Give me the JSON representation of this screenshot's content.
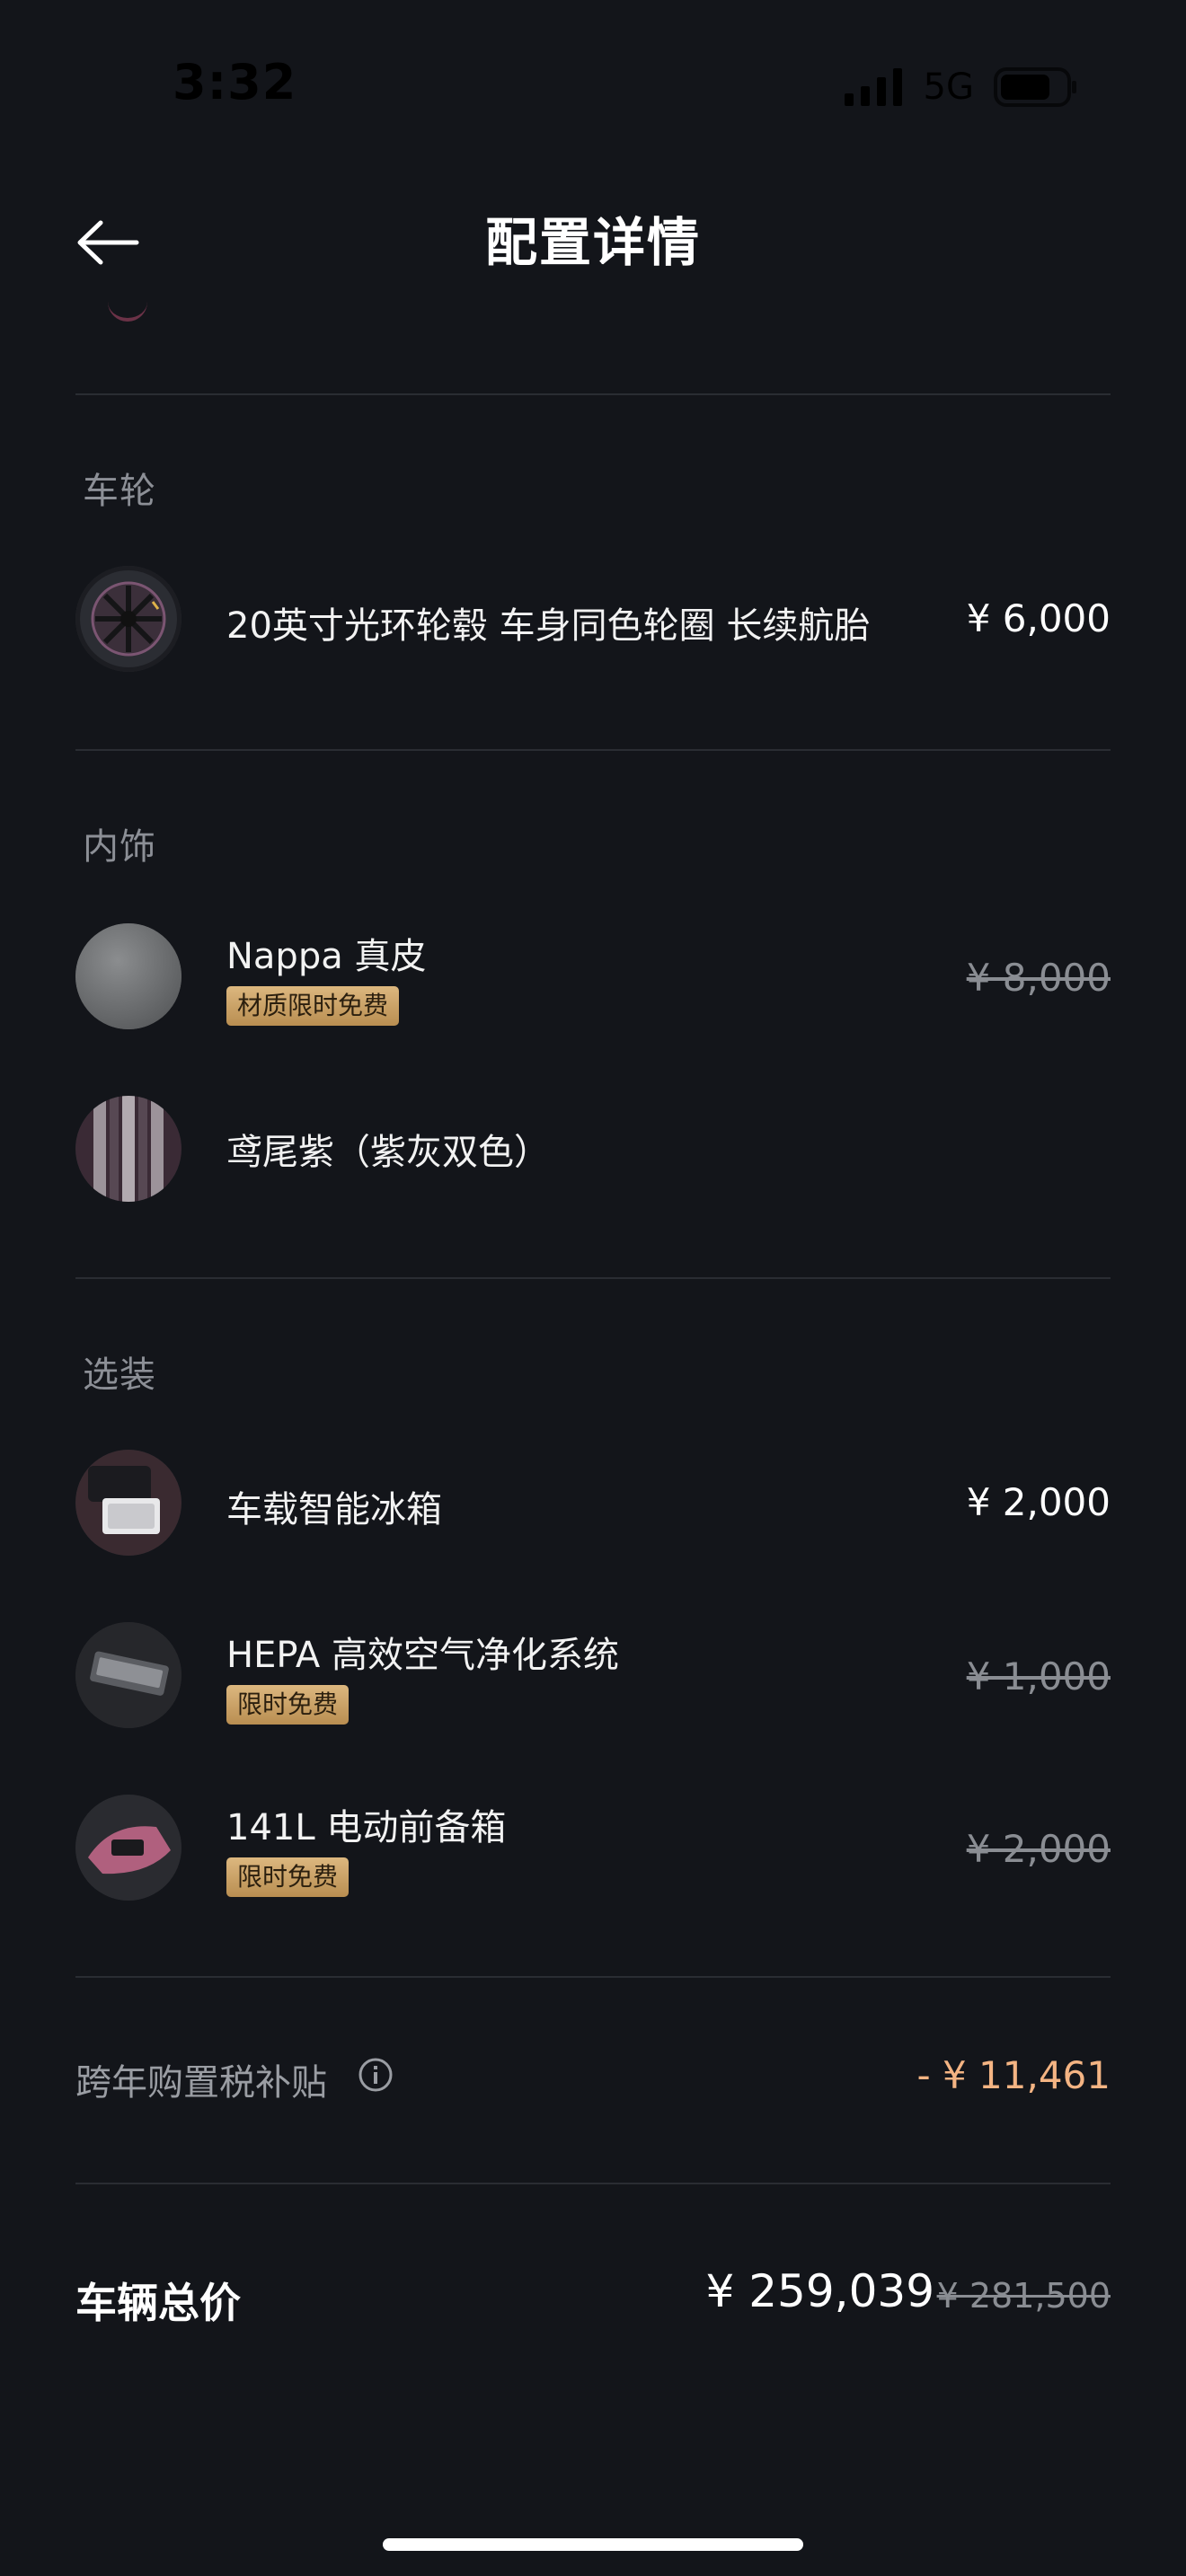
{
  "status_bar": {
    "time": "3:32",
    "network": "5G"
  },
  "header": {
    "title": "配置详情"
  },
  "sections": {
    "wheels": {
      "title": "车轮",
      "items": [
        {
          "name": "20英寸光环轮毂 车身同色轮圈 长续航胎",
          "price": "¥ 6,000"
        }
      ]
    },
    "interior": {
      "title": "内饰",
      "items": [
        {
          "name": "Nappa 真皮",
          "price": "¥ 8,000",
          "badge": "材质限时免费"
        },
        {
          "name": "鸢尾紫（紫灰双色）"
        }
      ]
    },
    "options": {
      "title": "选装",
      "items": [
        {
          "name": "车载智能冰箱",
          "price": "¥ 2,000"
        },
        {
          "name": "HEPA 高效空气净化系统",
          "price": "¥ 1,000",
          "badge": "限时免费"
        },
        {
          "name": "141L 电动前备箱",
          "price": "¥ 2,000",
          "badge": "限时免费"
        }
      ]
    }
  },
  "subsidy": {
    "label": "跨年购置税补贴",
    "value": "- ¥ 11,461"
  },
  "total": {
    "label": "车辆总价",
    "price": "¥ 259,039",
    "original": "¥ 281,500"
  },
  "colors": {
    "background": "#13151a",
    "accent_discount": "#f4b483",
    "badge_gold": "#c9a066"
  }
}
